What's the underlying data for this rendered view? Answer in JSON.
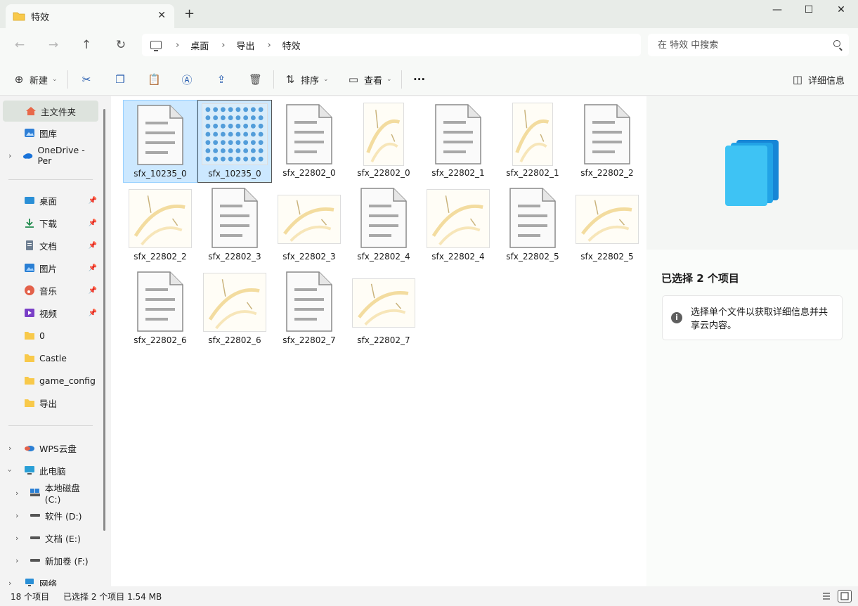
{
  "window": {
    "tab_title": "特效",
    "tab_close": "✕",
    "new_tab": "+",
    "minimize": "—",
    "maximize": "☐",
    "close": "✕"
  },
  "nav": {
    "back": "←",
    "forward": "→",
    "up": "↑",
    "refresh": "↻",
    "breadcrumbs": [
      "桌面",
      "导出",
      "特效"
    ],
    "sep": "›",
    "search_placeholder": "在 特效 中搜索"
  },
  "toolbar": {
    "new_label": "新建",
    "sort_label": "排序",
    "view_label": "查看",
    "more_label": "···",
    "details_label": "详细信息"
  },
  "sidebar": {
    "quick": [
      {
        "label": "主文件夹",
        "icon": "home-icon",
        "selected": true
      },
      {
        "label": "图库",
        "icon": "gallery-icon"
      },
      {
        "label": "OneDrive - Per",
        "icon": "onedrive-icon",
        "expandable": true
      }
    ],
    "pinned": [
      {
        "label": "桌面",
        "icon": "desktop-icon"
      },
      {
        "label": "下载",
        "icon": "download-icon"
      },
      {
        "label": "文档",
        "icon": "documents-icon"
      },
      {
        "label": "图片",
        "icon": "pictures-icon"
      },
      {
        "label": "音乐",
        "icon": "music-icon"
      },
      {
        "label": "视频",
        "icon": "videos-icon"
      }
    ],
    "folders": [
      "0",
      "Castle",
      "game_config",
      "导出"
    ],
    "places": [
      {
        "label": "WPS云盘",
        "icon": "wps-cloud-icon"
      },
      {
        "label": "此电脑",
        "icon": "this-pc-icon"
      },
      {
        "label": "本地磁盘 (C:)",
        "icon": "drive-c-icon"
      },
      {
        "label": "软件 (D:)",
        "icon": "drive-icon"
      },
      {
        "label": "文档 (E:)",
        "icon": "drive-icon"
      },
      {
        "label": "新加卷 (F:)",
        "icon": "drive-icon"
      },
      {
        "label": "网络",
        "icon": "network-icon"
      }
    ]
  },
  "files": [
    {
      "name": "sfx_10235_0",
      "kind": "doc",
      "selected": true
    },
    {
      "name": "sfx_10235_0",
      "kind": "image-blue",
      "selected": true
    },
    {
      "name": "sfx_22802_0",
      "kind": "doc"
    },
    {
      "name": "sfx_22802_0",
      "kind": "image-tall"
    },
    {
      "name": "sfx_22802_1",
      "kind": "doc"
    },
    {
      "name": "sfx_22802_1",
      "kind": "image-tall"
    },
    {
      "name": "sfx_22802_2",
      "kind": "doc"
    },
    {
      "name": "sfx_22802_2",
      "kind": "image-square"
    },
    {
      "name": "sfx_22802_3",
      "kind": "doc"
    },
    {
      "name": "sfx_22802_3",
      "kind": "image-wide"
    },
    {
      "name": "sfx_22802_4",
      "kind": "doc"
    },
    {
      "name": "sfx_22802_4",
      "kind": "image-square"
    },
    {
      "name": "sfx_22802_5",
      "kind": "doc"
    },
    {
      "name": "sfx_22802_5",
      "kind": "image-wide"
    },
    {
      "name": "sfx_22802_6",
      "kind": "doc"
    },
    {
      "name": "sfx_22802_6",
      "kind": "image-square"
    },
    {
      "name": "sfx_22802_7",
      "kind": "doc"
    },
    {
      "name": "sfx_22802_7",
      "kind": "image-wide"
    }
  ],
  "details": {
    "title": "已选择 2 个项目",
    "info_icon": "i",
    "info_text": "选择单个文件以获取详细信息并共享云内容。"
  },
  "status": {
    "count": "18 个项目",
    "selection": "已选择 2 个项目  1.54 MB"
  },
  "colors": {
    "accent": "#0067c0",
    "selection_bg": "#cce8ff",
    "folder": "#f8c94a"
  }
}
